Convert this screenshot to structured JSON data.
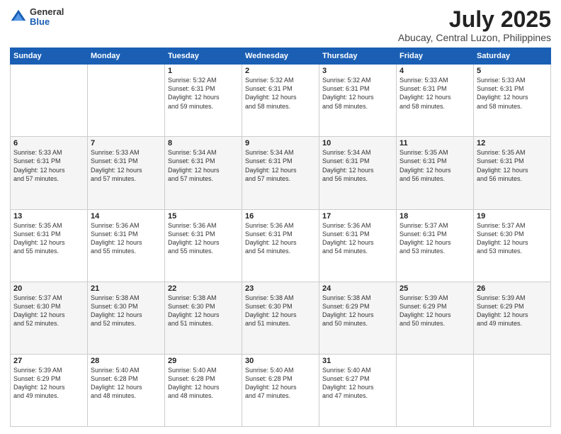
{
  "logo": {
    "general": "General",
    "blue": "Blue"
  },
  "title": "July 2025",
  "subtitle": "Abucay, Central Luzon, Philippines",
  "weekdays": [
    "Sunday",
    "Monday",
    "Tuesday",
    "Wednesday",
    "Thursday",
    "Friday",
    "Saturday"
  ],
  "weeks": [
    [
      {
        "day": "",
        "info": ""
      },
      {
        "day": "",
        "info": ""
      },
      {
        "day": "1",
        "info": "Sunrise: 5:32 AM\nSunset: 6:31 PM\nDaylight: 12 hours\nand 59 minutes."
      },
      {
        "day": "2",
        "info": "Sunrise: 5:32 AM\nSunset: 6:31 PM\nDaylight: 12 hours\nand 58 minutes."
      },
      {
        "day": "3",
        "info": "Sunrise: 5:32 AM\nSunset: 6:31 PM\nDaylight: 12 hours\nand 58 minutes."
      },
      {
        "day": "4",
        "info": "Sunrise: 5:33 AM\nSunset: 6:31 PM\nDaylight: 12 hours\nand 58 minutes."
      },
      {
        "day": "5",
        "info": "Sunrise: 5:33 AM\nSunset: 6:31 PM\nDaylight: 12 hours\nand 58 minutes."
      }
    ],
    [
      {
        "day": "6",
        "info": "Sunrise: 5:33 AM\nSunset: 6:31 PM\nDaylight: 12 hours\nand 57 minutes."
      },
      {
        "day": "7",
        "info": "Sunrise: 5:33 AM\nSunset: 6:31 PM\nDaylight: 12 hours\nand 57 minutes."
      },
      {
        "day": "8",
        "info": "Sunrise: 5:34 AM\nSunset: 6:31 PM\nDaylight: 12 hours\nand 57 minutes."
      },
      {
        "day": "9",
        "info": "Sunrise: 5:34 AM\nSunset: 6:31 PM\nDaylight: 12 hours\nand 57 minutes."
      },
      {
        "day": "10",
        "info": "Sunrise: 5:34 AM\nSunset: 6:31 PM\nDaylight: 12 hours\nand 56 minutes."
      },
      {
        "day": "11",
        "info": "Sunrise: 5:35 AM\nSunset: 6:31 PM\nDaylight: 12 hours\nand 56 minutes."
      },
      {
        "day": "12",
        "info": "Sunrise: 5:35 AM\nSunset: 6:31 PM\nDaylight: 12 hours\nand 56 minutes."
      }
    ],
    [
      {
        "day": "13",
        "info": "Sunrise: 5:35 AM\nSunset: 6:31 PM\nDaylight: 12 hours\nand 55 minutes."
      },
      {
        "day": "14",
        "info": "Sunrise: 5:36 AM\nSunset: 6:31 PM\nDaylight: 12 hours\nand 55 minutes."
      },
      {
        "day": "15",
        "info": "Sunrise: 5:36 AM\nSunset: 6:31 PM\nDaylight: 12 hours\nand 55 minutes."
      },
      {
        "day": "16",
        "info": "Sunrise: 5:36 AM\nSunset: 6:31 PM\nDaylight: 12 hours\nand 54 minutes."
      },
      {
        "day": "17",
        "info": "Sunrise: 5:36 AM\nSunset: 6:31 PM\nDaylight: 12 hours\nand 54 minutes."
      },
      {
        "day": "18",
        "info": "Sunrise: 5:37 AM\nSunset: 6:31 PM\nDaylight: 12 hours\nand 53 minutes."
      },
      {
        "day": "19",
        "info": "Sunrise: 5:37 AM\nSunset: 6:30 PM\nDaylight: 12 hours\nand 53 minutes."
      }
    ],
    [
      {
        "day": "20",
        "info": "Sunrise: 5:37 AM\nSunset: 6:30 PM\nDaylight: 12 hours\nand 52 minutes."
      },
      {
        "day": "21",
        "info": "Sunrise: 5:38 AM\nSunset: 6:30 PM\nDaylight: 12 hours\nand 52 minutes."
      },
      {
        "day": "22",
        "info": "Sunrise: 5:38 AM\nSunset: 6:30 PM\nDaylight: 12 hours\nand 51 minutes."
      },
      {
        "day": "23",
        "info": "Sunrise: 5:38 AM\nSunset: 6:30 PM\nDaylight: 12 hours\nand 51 minutes."
      },
      {
        "day": "24",
        "info": "Sunrise: 5:38 AM\nSunset: 6:29 PM\nDaylight: 12 hours\nand 50 minutes."
      },
      {
        "day": "25",
        "info": "Sunrise: 5:39 AM\nSunset: 6:29 PM\nDaylight: 12 hours\nand 50 minutes."
      },
      {
        "day": "26",
        "info": "Sunrise: 5:39 AM\nSunset: 6:29 PM\nDaylight: 12 hours\nand 49 minutes."
      }
    ],
    [
      {
        "day": "27",
        "info": "Sunrise: 5:39 AM\nSunset: 6:29 PM\nDaylight: 12 hours\nand 49 minutes."
      },
      {
        "day": "28",
        "info": "Sunrise: 5:40 AM\nSunset: 6:28 PM\nDaylight: 12 hours\nand 48 minutes."
      },
      {
        "day": "29",
        "info": "Sunrise: 5:40 AM\nSunset: 6:28 PM\nDaylight: 12 hours\nand 48 minutes."
      },
      {
        "day": "30",
        "info": "Sunrise: 5:40 AM\nSunset: 6:28 PM\nDaylight: 12 hours\nand 47 minutes."
      },
      {
        "day": "31",
        "info": "Sunrise: 5:40 AM\nSunset: 6:27 PM\nDaylight: 12 hours\nand 47 minutes."
      },
      {
        "day": "",
        "info": ""
      },
      {
        "day": "",
        "info": ""
      }
    ]
  ]
}
